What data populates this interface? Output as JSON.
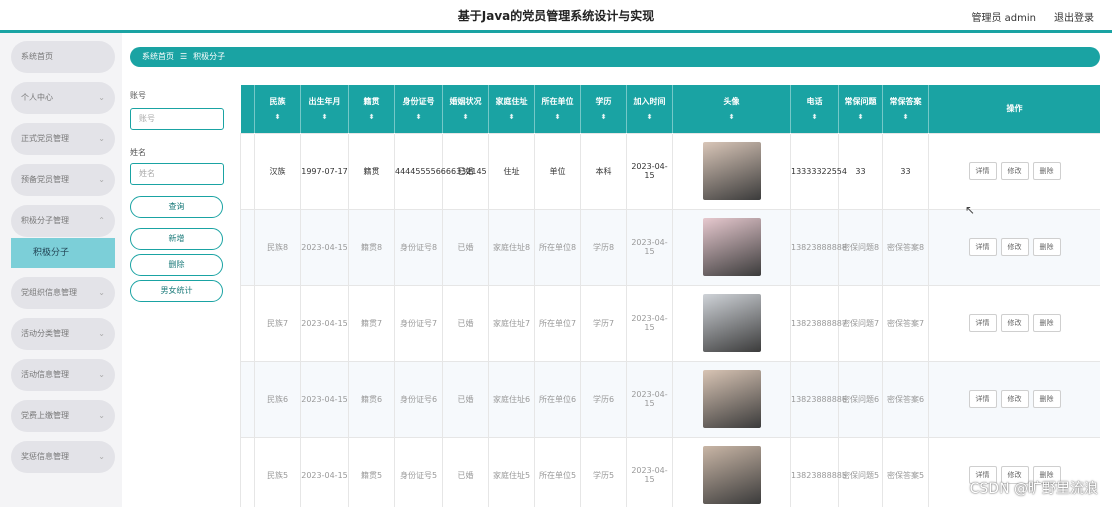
{
  "header": {
    "title": "基于Java的党员管理系统设计与实现",
    "admin": "管理员 admin",
    "logout": "退出登录"
  },
  "sidebar": {
    "items": [
      {
        "label": "系统首页",
        "chevron": ""
      },
      {
        "label": "个人中心",
        "chevron": "⌄"
      },
      {
        "label": "正式党员管理",
        "chevron": "⌄"
      },
      {
        "label": "预备党员管理",
        "chevron": "⌄"
      },
      {
        "label": "积极分子管理",
        "chevron": "⌃"
      },
      {
        "label": "党组织信息管理",
        "chevron": "⌄"
      },
      {
        "label": "活动分类管理",
        "chevron": "⌄"
      },
      {
        "label": "活动信息管理",
        "chevron": "⌄"
      },
      {
        "label": "党费上缴管理",
        "chevron": "⌄"
      },
      {
        "label": "奖惩信息管理",
        "chevron": "⌄"
      }
    ],
    "sub_item": "积极分子"
  },
  "breadcrumb": {
    "home": "系统首页",
    "sep": "☰",
    "current": "积极分子"
  },
  "filters": {
    "account_label": "账号",
    "account_placeholder": "账号",
    "name_label": "姓名",
    "name_placeholder": "姓名",
    "search_button": "查询",
    "add_button": "新增",
    "delete_button": "删除",
    "stats_button": "男女统计"
  },
  "table": {
    "headers": [
      "民族",
      "出生年月",
      "籍贯",
      "身份证号",
      "婚姻状况",
      "家庭住址",
      "所在单位",
      "学历",
      "加入时间",
      "头像",
      "电话",
      "常保问题",
      "常保答案",
      "操作"
    ],
    "sort_icon": "⬍",
    "rows": [
      {
        "cells": [
          "汉族",
          "1997-07-17",
          "籍贯",
          "444455556666332145",
          "已婚",
          "住址",
          "单位",
          "本科",
          "2023-04-15",
          "",
          "13333322554",
          "33",
          "33"
        ]
      },
      {
        "cells": [
          "民族8",
          "2023-04-15",
          "籍贯8",
          "身份证号8",
          "已婚",
          "家庭住址8",
          "所在单位8",
          "学历8",
          "2023-04-15",
          "",
          "13823888888",
          "密保问题8",
          "密保答案8"
        ]
      },
      {
        "cells": [
          "民族7",
          "2023-04-15",
          "籍贯7",
          "身份证号7",
          "已婚",
          "家庭住址7",
          "所在单位7",
          "学历7",
          "2023-04-15",
          "",
          "13823888887",
          "密保问题7",
          "密保答案7"
        ]
      },
      {
        "cells": [
          "民族6",
          "2023-04-15",
          "籍贯6",
          "身份证号6",
          "已婚",
          "家庭住址6",
          "所在单位6",
          "学历6",
          "2023-04-15",
          "",
          "13823888886",
          "密保问题6",
          "密保答案6"
        ]
      },
      {
        "cells": [
          "民族5",
          "2023-04-15",
          "籍贯5",
          "身份证号5",
          "已婚",
          "家庭住址5",
          "所在单位5",
          "学历5",
          "2023-04-15",
          "",
          "13823888885",
          "密保问题5",
          "密保答案5"
        ]
      }
    ],
    "ops": {
      "detail": "详情",
      "edit": "修改",
      "delete": "删除"
    }
  },
  "watermark": "CSDN @旷野里流浪",
  "colors": {
    "accent": "#1aa3a3",
    "sub_active": "#7ccfd8"
  }
}
